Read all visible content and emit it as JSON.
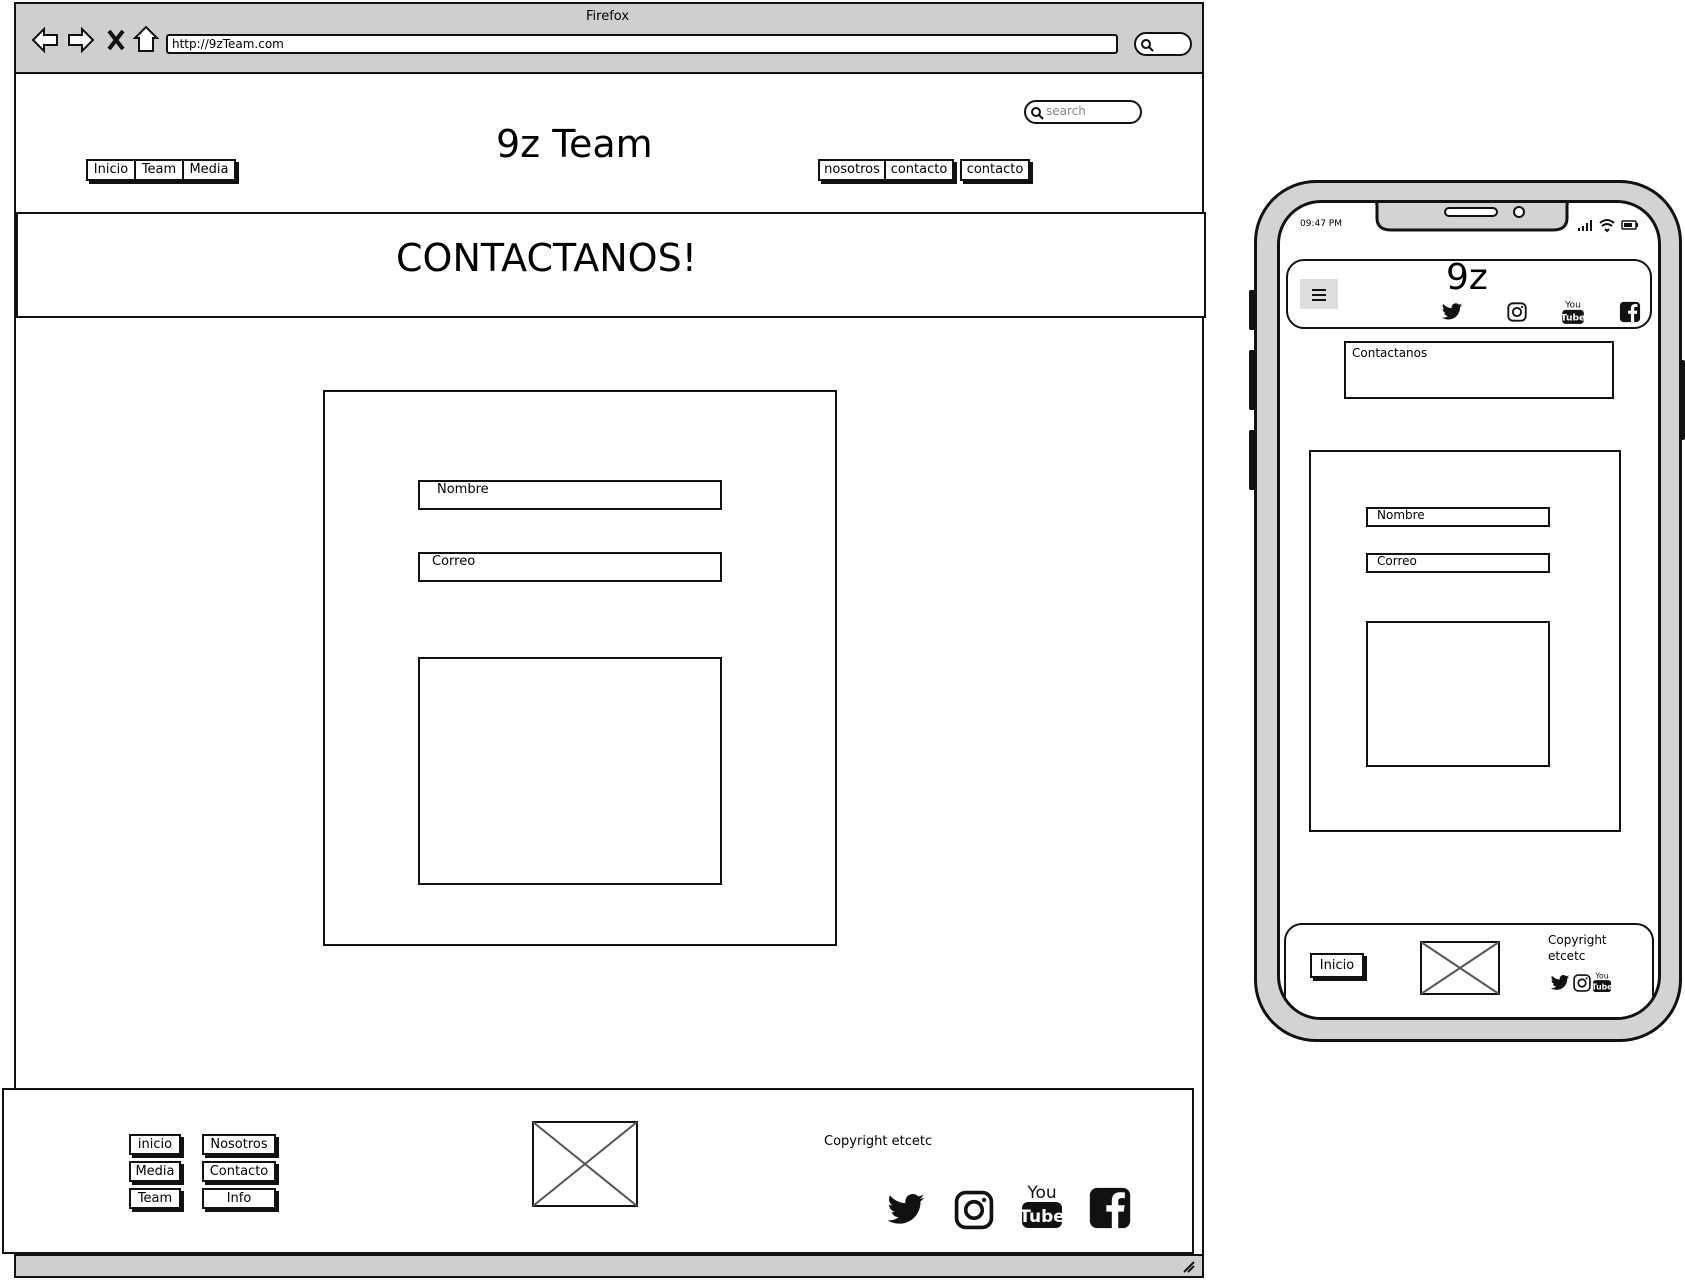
{
  "browser": {
    "title": "Firefox",
    "url": "http://9zTeam.com"
  },
  "site": {
    "search_placeholder": "search",
    "brand": "9z Team",
    "nav_left": [
      "Inicio",
      "Team",
      "Media"
    ],
    "nav_right": [
      "nosotros",
      "contacto",
      "contacto"
    ],
    "hero_title": "CONTACTANOS!",
    "form": {
      "name_label": "Nombre",
      "email_label": "Correo"
    },
    "footer": {
      "links_col1": [
        "inicio",
        "Media",
        "Team"
      ],
      "links_col2": [
        "Nosotros",
        "Contacto",
        "Info"
      ],
      "copyright": "Copyright etcetc",
      "social_icons": [
        "twitter-icon",
        "instagram-icon",
        "youtube-icon",
        "facebook-icon"
      ]
    }
  },
  "phone": {
    "time": "09:47 PM",
    "brand": "9z",
    "section_title": "Contactanos",
    "form": {
      "name_label": "Nombre",
      "email_label": "Correo"
    },
    "footer": {
      "button": "Inicio",
      "copyright_line1": "Copyright",
      "copyright_line2": "etcetc"
    }
  }
}
